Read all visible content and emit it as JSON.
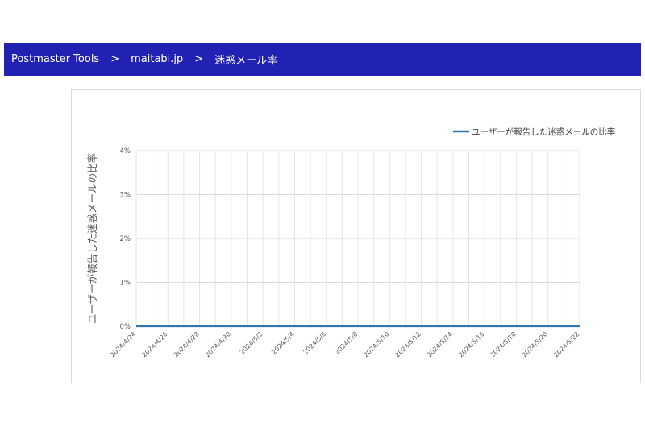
{
  "breadcrumb": {
    "root": "Postmaster Tools",
    "separator": ">",
    "domain": "maitabi.jp",
    "page": "迷惑メール率"
  },
  "chart_data": {
    "type": "line",
    "ylabel": "ユーザーが報告した迷惑メールの比率",
    "xlabel": "",
    "legend_position": "top-right",
    "grid": true,
    "ylim": [
      0,
      4
    ],
    "y_ticks": [
      "0%",
      "1%",
      "2%",
      "3%",
      "4%"
    ],
    "x": [
      "2024/4/24",
      "2024/4/25",
      "2024/4/26",
      "2024/4/27",
      "2024/4/28",
      "2024/4/29",
      "2024/4/30",
      "2024/5/1",
      "2024/5/2",
      "2024/5/3",
      "2024/5/4",
      "2024/5/5",
      "2024/5/6",
      "2024/5/7",
      "2024/5/8",
      "2024/5/9",
      "2024/5/10",
      "2024/5/11",
      "2024/5/12",
      "2024/5/13",
      "2024/5/14",
      "2024/5/15",
      "2024/5/16",
      "2024/5/17",
      "2024/5/18",
      "2024/5/19",
      "2024/5/20",
      "2024/5/21",
      "2024/5/22"
    ],
    "x_tick_labels": [
      "2024/4/24",
      "2024/4/26",
      "2024/4/28",
      "2024/4/30",
      "2024/5/2",
      "2024/5/4",
      "2024/5/6",
      "2024/5/8",
      "2024/5/10",
      "2024/5/12",
      "2024/5/14",
      "2024/5/16",
      "2024/5/18",
      "2024/5/20",
      "2024/5/22"
    ],
    "series": [
      {
        "name": "ユーザーが報告した迷惑メールの比率",
        "color": "#2e75b6",
        "values": [
          0,
          0,
          0,
          0,
          0,
          0,
          0,
          0,
          0,
          0,
          0,
          0,
          0,
          0,
          0,
          0,
          0,
          0,
          0,
          0,
          0,
          0,
          0,
          0,
          0,
          0,
          0,
          0,
          0
        ]
      }
    ]
  }
}
